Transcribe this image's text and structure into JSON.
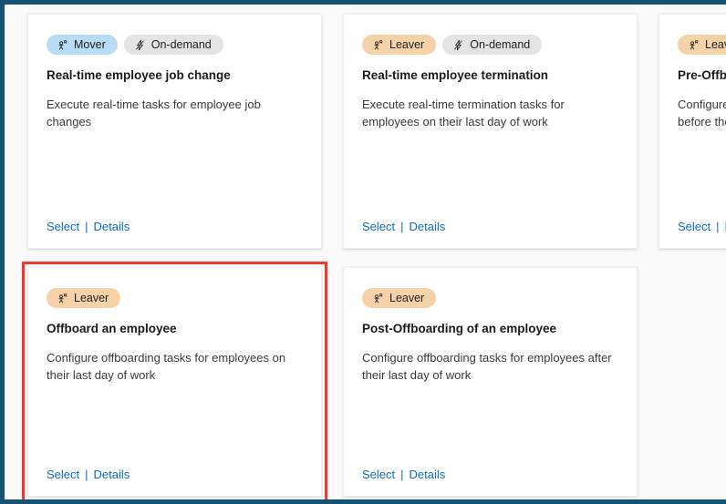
{
  "window": {
    "border_color": "#145374",
    "background": "#fafafa",
    "highlight_color": "#f03a2e"
  },
  "palette": {
    "accent_link": "#0f6cbd",
    "badge_mover_bg": "#b7dcf3",
    "badge_leaver_bg": "#f6d2a8",
    "badge_ondemand_bg": "#e4e4e4",
    "title_color": "#1b1a19",
    "body_color": "#3b3a39"
  },
  "links": {
    "select_label": "Select",
    "separator": "|",
    "details_label": "Details"
  },
  "cards": [
    {
      "id": "real-time-employee-job-change",
      "badges": [
        {
          "label": "Mover",
          "icon": "person-mover-icon",
          "style": "mover"
        },
        {
          "label": "On-demand",
          "icon": "lightning-bolt-icon",
          "style": "ondemand"
        }
      ],
      "title": "Real-time employee job change",
      "description": "Execute real-time tasks for employee job changes",
      "selected": false,
      "clipped": false
    },
    {
      "id": "real-time-employee-termination",
      "badges": [
        {
          "label": "Leaver",
          "icon": "person-leaver-icon",
          "style": "leaver"
        },
        {
          "label": "On-demand",
          "icon": "lightning-bolt-icon",
          "style": "ondemand"
        }
      ],
      "title": "Real-time employee termination",
      "description": "Execute real-time termination tasks for employees on their last day of work",
      "selected": false,
      "clipped": false
    },
    {
      "id": "pre-offboarding",
      "badges": [
        {
          "label": "Leaver",
          "icon": "person-leaver-icon",
          "style": "leaver"
        }
      ],
      "title": "Pre-Offboarding of an employee",
      "description": "Configure pre-offboarding tasks for employees before their last day of work",
      "selected": false,
      "clipped": true
    },
    {
      "id": "offboard-an-employee",
      "badges": [
        {
          "label": "Leaver",
          "icon": "person-leaver-icon",
          "style": "leaver"
        }
      ],
      "title": "Offboard an employee",
      "description": "Configure offboarding tasks for employees on their last day of work",
      "selected": true,
      "clipped": false
    },
    {
      "id": "post-offboarding-of-an-employee",
      "badges": [
        {
          "label": "Leaver",
          "icon": "person-leaver-icon",
          "style": "leaver"
        }
      ],
      "title": "Post-Offboarding of an employee",
      "description": "Configure offboarding tasks for employees after their last day of work",
      "selected": false,
      "clipped": false
    }
  ]
}
